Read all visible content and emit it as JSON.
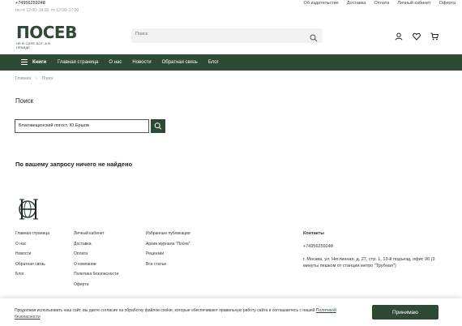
{
  "topbar": {
    "phone": "+74956259248",
    "hours": "пн-чт 12:00–18:00, пт 12:00–17:00",
    "links": [
      "Об издательстве",
      "Доставка",
      "Оплата",
      "Личный кабинет",
      "Оферта"
    ]
  },
  "logo": {
    "word": "ПОСЕВ",
    "tagline": "НЕ В СИЛЕ БОГ, А В ПРАВДЕ"
  },
  "search": {
    "placeholder": "Поиск"
  },
  "header_icons": [
    "user-icon",
    "heart-icon",
    "cart-icon"
  ],
  "nav": {
    "books_label": "Книги",
    "links": [
      "Главная страница",
      "О нас",
      "Новости",
      "Обратная связь",
      "Блог"
    ]
  },
  "breadcrumb": [
    "Главная",
    "Поиск"
  ],
  "page": {
    "title": "Поиск",
    "query": "Благовещенский погост, Ю.Ершов",
    "no_results": "По вашему запросу ничего не найдено"
  },
  "footer": {
    "col1": [
      "Главная страница",
      "О нас",
      "Новости",
      "Обратная связь",
      "Блог"
    ],
    "col2": [
      "Личный кабинет",
      "Доставка",
      "Оплата",
      "О компании",
      "Политика безопасности",
      "Оферта"
    ],
    "col3": [
      "Избранные публикации",
      "Архив журнала \"Посев\"",
      "Рецензии",
      "Все статьи"
    ],
    "contacts_title": "Контакты",
    "contacts_phone": "+74956259248",
    "contacts_address": "г. Москва, ул. Неглинная, д. 27, стр. 1, 13-й подъезд, офис 9б (3 минуты пешком от станции метро \"Трубная\")"
  },
  "cookie": {
    "text": "Продолжая использовать наш сайт, вы даете согласие на обработку файлов cookie, которые обеспечивают правильную работу сайта и соглашаетесь с нашей",
    "link": "Политикой безопасности",
    "button": "Принимаю"
  },
  "colors": {
    "brand_green": "#2e4a35"
  }
}
